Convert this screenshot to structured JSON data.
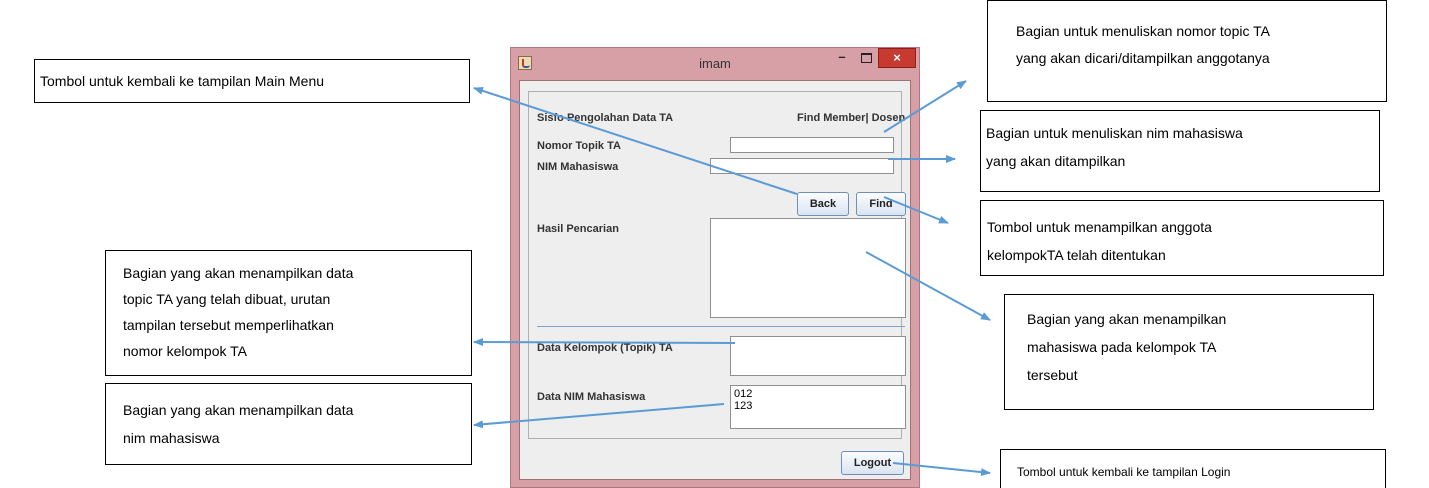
{
  "window": {
    "title": "imam",
    "minimize_glyph": "–",
    "close_glyph": "×"
  },
  "form": {
    "app_name": "Sisfo Pengolahan Data TA",
    "page_title": "Find Member| Dosen",
    "topic_label": "Nomor Topik TA",
    "topic_value": "",
    "nim_label": "NIM Mahasiswa",
    "nim_value": "",
    "back_label": "Back",
    "find_label": "Find",
    "result_label": "Hasil Pencarian",
    "result_value": "",
    "group_label": "Data Kelompok (Topik) TA",
    "group_value": "",
    "nim_data_label": "Data NIM Mahasiswa",
    "nim_data_value": "012\n123",
    "logout_label": "Logout"
  },
  "callouts": {
    "main_menu": "Tombol untuk kembali ke tampilan Main Menu",
    "topic_line1": "Bagian untuk menuliskan nomor topic TA",
    "topic_line2": "yang akan dicari/ditampilkan anggotanya",
    "nim_line1": "Bagian untuk menuliskan nim mahasiswa",
    "nim_line2": "yang akan ditampilkan",
    "find_line1": "Tombol untuk menampilkan  anggota",
    "find_line2": "kelompokTA  telah ditentukan",
    "topicdata_line1": "Bagian yang akan menampilkan data",
    "topicdata_line2": "topic TA yang telah dibuat, urutan",
    "topicdata_line3": "tampilan tersebut memperlihatkan",
    "topicdata_line4": "nomor kelompok TA",
    "result_line1": "Bagian yang akan menampilkan",
    "result_line2": "mahasiswa pada kelompok TA",
    "result_line3": "tersebut",
    "nimdata_line1": "Bagian yang akan menampilkan data",
    "nimdata_line2": "nim mahasiswa",
    "login": "Tombol untuk kembali ke tampilan Login"
  },
  "colors": {
    "arrow": "#5b9bd5",
    "window_frame": "#d7a0a6",
    "close_button": "#c73a30"
  }
}
